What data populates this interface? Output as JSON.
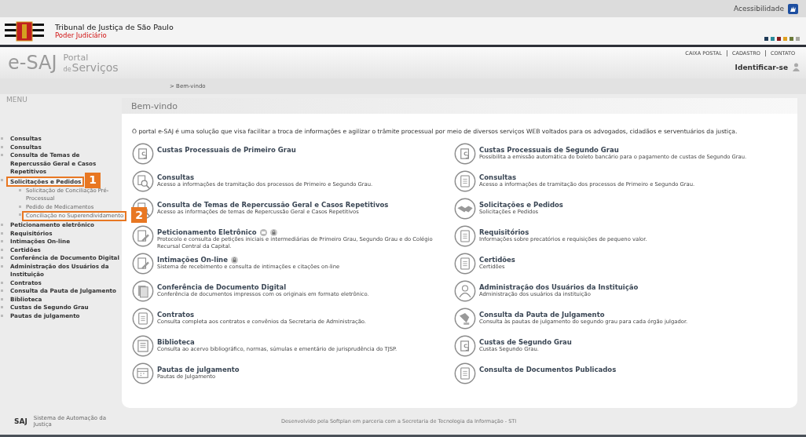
{
  "top_bar": {
    "accessibility": "Acessibilidade"
  },
  "header": {
    "title": "Tribunal de Justiça de São Paulo",
    "subtitle": "Poder Judiciário",
    "swatches": [
      {
        "color": "#1f3b57"
      },
      {
        "color": "#2a8a9a"
      },
      {
        "color": "#8a1a1a"
      },
      {
        "color": "#e0a020"
      },
      {
        "color": "#6a7a3a"
      },
      {
        "color": "#a8a8a0"
      }
    ]
  },
  "portal": {
    "logo": "e-SAJ",
    "name_top": "Portal",
    "name_de": "de",
    "name_bottom": "Serviços",
    "links": [
      "CAIXA POSTAL",
      "CADASTRO",
      "CONTATO"
    ],
    "login": "Identificar-se"
  },
  "breadcrumb": "> Bem-vindo",
  "sidebar": {
    "title": "MENU",
    "items": [
      {
        "label": "Consultas"
      },
      {
        "label": "Consultas"
      },
      {
        "label": "Consulta de Temas de Repercussão Geral e Casos Repetitivos"
      },
      {
        "label": "Solicitações e Pedidos",
        "callout": "1",
        "children": [
          {
            "label": "Solicitação de Conciliação Pré-Processual"
          },
          {
            "label": "Pedido de Medicamentos"
          },
          {
            "label": "Conciliação no Superendividamento",
            "callout": "2"
          }
        ]
      },
      {
        "label": "Peticionamento eletrônico"
      },
      {
        "label": "Requisitórios"
      },
      {
        "label": "Intimações On-line"
      },
      {
        "label": "Certidões"
      },
      {
        "label": "Conferência de Documento Digital"
      },
      {
        "label": "Administração dos Usuários da Instituição"
      },
      {
        "label": "Contratos"
      },
      {
        "label": "Consulta da Pauta de Julgamento"
      },
      {
        "label": "Biblioteca"
      },
      {
        "label": "Custas de Segundo Grau"
      },
      {
        "label": "Pautas de julgamento"
      }
    ]
  },
  "main": {
    "heading": "Bem-vindo",
    "intro": "O portal e-SAJ é uma solução que visa facilitar a troca de informações e agilizar o trâmite processual por meio de diversos serviços WEB voltados para os advogados, cidadãos e serventuários da justiça.",
    "services": [
      {
        "title": "Custas Processuais de Primeiro Grau"
      },
      {
        "title": "Custas Processuais de Segundo Grau",
        "description": "Possibilita a emissão automática do boleto bancário para o pagamento de custas de Segundo Grau."
      },
      {
        "title": "Consultas",
        "description": "Acesso a informações de tramitação dos processos de Primeiro e Segundo Grau."
      },
      {
        "title": "Consultas",
        "description": "Acesso a informações de tramitação dos processos de Primeiro e Segundo Grau."
      },
      {
        "title": "Consulta de Temas de Repercussão Geral e Casos Repetitivos",
        "description": "Acesso as informações de temas de Repercussão Geral e Casos Repetitivos"
      },
      {
        "title": "Solicitações e Pedidos",
        "description": "Solicitações e Pedidos"
      },
      {
        "title": "Peticionamento Eletrônico",
        "certificate": true,
        "locked": true,
        "description": "Protocolo e consulta de petições iniciais e intermediárias de Primeiro Grau, Segundo Grau e do Colégio Recursal Central da Capital."
      },
      {
        "title": "Requisitórios",
        "description": "Informações sobre precatórios e requisições de pequeno valor."
      },
      {
        "title": "Intimações On-line",
        "locked": true,
        "description": "Sistema de recebimento e consulta de intimações e citações on-line"
      },
      {
        "title": "Certidões",
        "description": "Certidões"
      },
      {
        "title": "Conferência de Documento Digital",
        "description": "Conferência de documentos impressos com os originais em formato eletrônico."
      },
      {
        "title": "Administração dos Usuários da Instituição",
        "description": "Administração dos usuários da instituição"
      },
      {
        "title": "Contratos",
        "description": "Consulta completa aos contratos e convênios da Secretaria de Administração."
      },
      {
        "title": "Consulta da Pauta de Julgamento",
        "description": "Consulta às pautas de julgamento do segundo grau para cada órgão julgador."
      },
      {
        "title": "Biblioteca",
        "description": "Consulta ao acervo bibliográfico, normas, súmulas e ementário de jurisprudência do TJSP."
      },
      {
        "title": "Custas de Segundo Grau",
        "description": "Custas Segundo Grau."
      },
      {
        "title": "Pautas de julgamento",
        "description": "Pautas de Julgamento"
      },
      {
        "title": "Consulta de Documentos Publicados"
      }
    ]
  },
  "footer": {
    "logo": "SAJ",
    "system": "Sistema de Automação da Justiça",
    "credit": "Desenvolvido pela Softplan em parceria com a Secretaria de Tecnologia da Informação - STI"
  }
}
